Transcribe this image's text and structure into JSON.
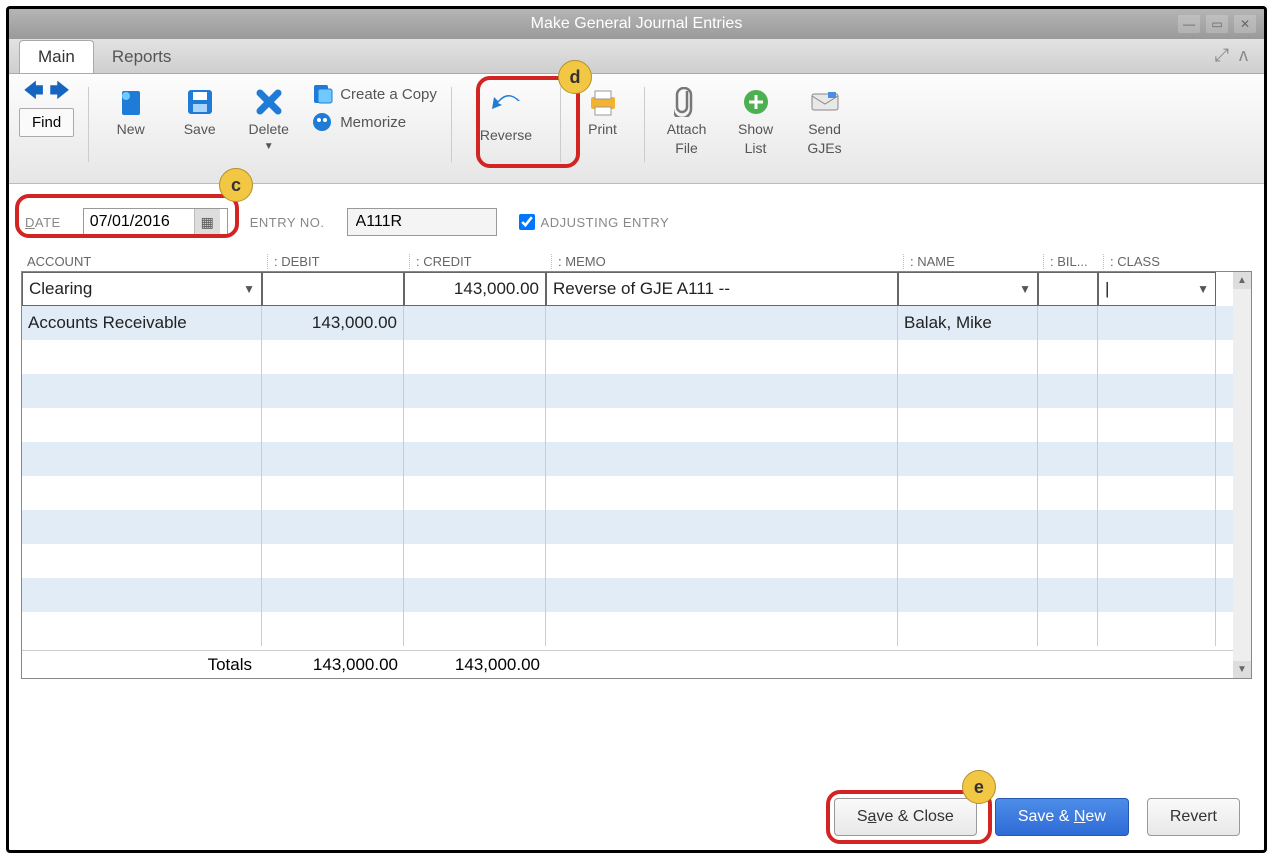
{
  "window": {
    "title": "Make General Journal Entries"
  },
  "tabs": {
    "main": "Main",
    "reports": "Reports"
  },
  "toolbar": {
    "find": "Find",
    "new": "New",
    "save": "Save",
    "delete": "Delete",
    "create_copy": "Create a Copy",
    "memorize": "Memorize",
    "reverse": "Reverse",
    "print": "Print",
    "attach_file_l1": "Attach",
    "attach_file_l2": "File",
    "show_list_l1": "Show",
    "show_list_l2": "List",
    "send_gjes_l1": "Send",
    "send_gjes_l2": "GJEs"
  },
  "entry": {
    "date_label": "DATE",
    "date_value": "07/01/2016",
    "entryno_label": "ENTRY NO.",
    "entryno_value": "A111R",
    "adjusting_label": "ADJUSTING ENTRY",
    "adjusting_checked": true
  },
  "columns": {
    "account": "ACCOUNT",
    "debit": "DEBIT",
    "credit": "CREDIT",
    "memo": "MEMO",
    "name": "NAME",
    "bil": "BIL...",
    "class": "CLASS"
  },
  "rows": [
    {
      "account": "Clearing",
      "debit": "",
      "credit": "143,000.00",
      "memo": "Reverse of GJE A111 --",
      "name": "",
      "bil": "",
      "class": ""
    },
    {
      "account": "Accounts Receivable",
      "debit": "143,000.00",
      "credit": "",
      "memo": "",
      "name": "Balak, Mike",
      "bil": "",
      "class": ""
    }
  ],
  "totals": {
    "label": "Totals",
    "debit": "143,000.00",
    "credit": "143,000.00"
  },
  "footer": {
    "save_close": "Save & Close",
    "save_new": "Save & New",
    "revert": "Revert"
  },
  "callouts": {
    "c": "c",
    "d": "d",
    "e": "e"
  }
}
